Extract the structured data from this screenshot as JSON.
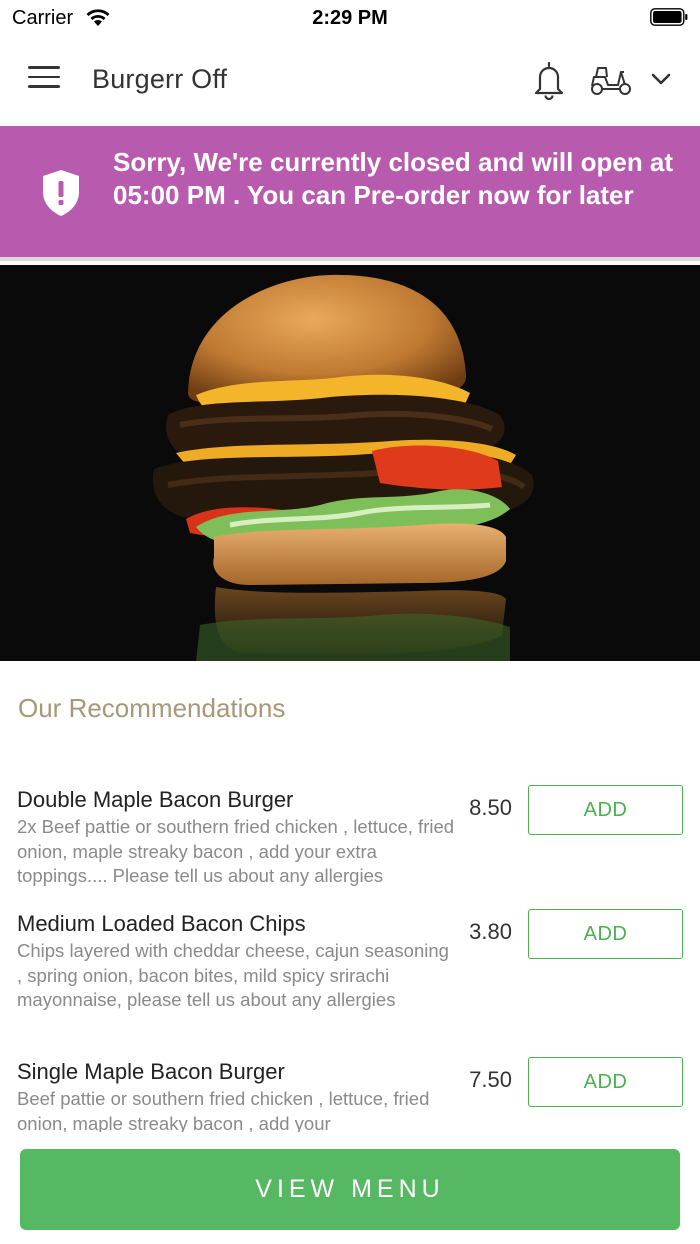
{
  "status_bar": {
    "carrier": "Carrier",
    "time": "2:29 PM"
  },
  "header": {
    "title": "Burgerr Off",
    "icons": [
      "menu-icon",
      "bell-icon",
      "scooter-icon",
      "chevron-down-icon"
    ]
  },
  "banner": {
    "message": "Sorry, We're currently closed and will open at 05:00 PM . You can Pre-order now for later",
    "icon": "shield-alert-icon",
    "color": "#b85baf"
  },
  "recommendations": {
    "title": "Our Recommendations",
    "items": [
      {
        "name": "Double Maple Bacon Burger",
        "description": "2x Beef pattie or southern fried chicken , lettuce, fried onion, maple streaky bacon , add your extra toppings.... Please tell us about any allergies",
        "price": "8.50",
        "button": "ADD"
      },
      {
        "name": "Medium Loaded Bacon Chips",
        "description": "Chips layered with cheddar cheese, cajun seasoning , spring onion, bacon bites, mild spicy srirachi mayonnaise,  please tell us about any allergies",
        "price": "3.80",
        "button": "ADD"
      },
      {
        "name": "Single Maple Bacon Burger",
        "description": "Beef pattie or southern fried chicken , lettuce, fried onion, maple streaky bacon ,   add your",
        "price": "7.50",
        "button": "ADD"
      }
    ]
  },
  "footer": {
    "view_menu_label": "VIEW MENU",
    "accent": "#56b862"
  }
}
